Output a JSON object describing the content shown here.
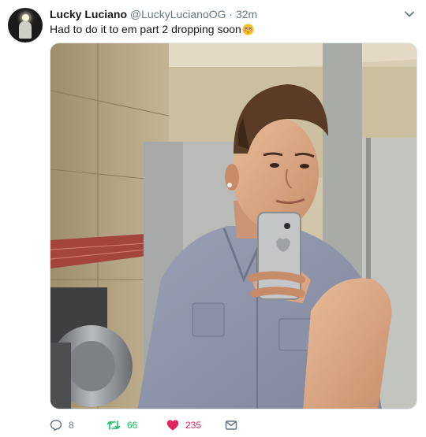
{
  "tweet": {
    "display_name": "Lucky Luciano",
    "handle": "@LuckyLucianoOG",
    "separator": "·",
    "time": "32m",
    "text": "Had to do it to em part 2 dropping soon",
    "emoji": "flushed-face-emoji"
  },
  "actions": {
    "reply_count": "8",
    "retweet_count": "66",
    "like_count": "235"
  },
  "colors": {
    "retweet_active": "#17bf63",
    "like_active": "#e0245e",
    "secondary_text": "#657786"
  }
}
